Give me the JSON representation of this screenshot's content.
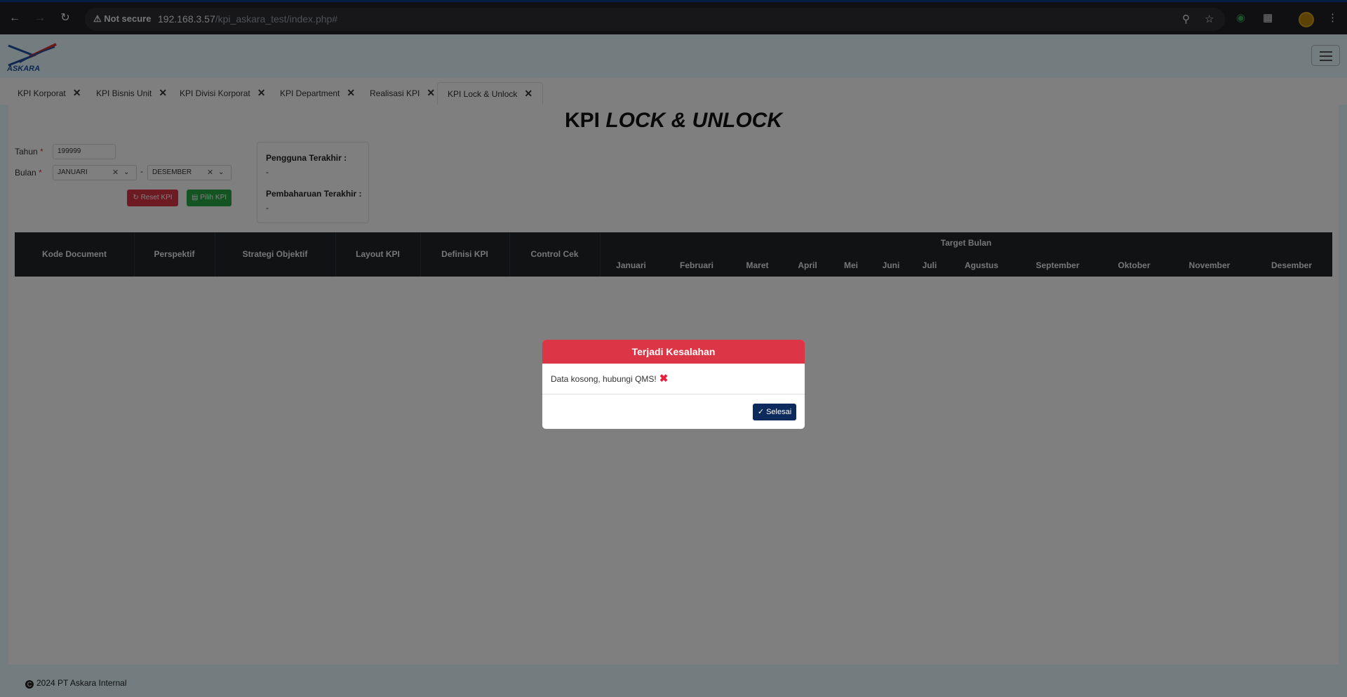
{
  "browser": {
    "security": "Not secure",
    "url_host": "192.168.3.57",
    "url_path": "/kpi_askara_test/index.php#"
  },
  "app": {
    "logo_text": "ASKARA"
  },
  "tabs": [
    {
      "label": "KPI Korporat"
    },
    {
      "label": "KPI Bisnis Unit"
    },
    {
      "label": "KPI Divisi Korporat"
    },
    {
      "label": "KPI Department"
    },
    {
      "label": "Realisasi KPI"
    },
    {
      "label": "KPI Lock & Unlock",
      "active": true
    }
  ],
  "page": {
    "title_prefix": "KPI",
    "title_italic": "LOCK & UNLOCK"
  },
  "form": {
    "tahun_label": "Tahun",
    "tahun_value": "199999",
    "bulan_label": "Bulan",
    "bulan_from": "JANUARI",
    "bulan_to": "DESEMBER",
    "separator": "-",
    "required_mark": "*",
    "reset_label": "Reset KPI",
    "pilih_label": "Pilih KPI"
  },
  "info": {
    "pengguna_label": "Pengguna Terakhir :",
    "pengguna_value": "-",
    "pembaharuan_label": "Pembaharuan Terakhir :",
    "pembaharuan_value": "-"
  },
  "table": {
    "headers": [
      "Kode Document",
      "Perspektif",
      "Strategi Objektif",
      "Layout KPI",
      "Definisi KPI",
      "Control Cek"
    ],
    "group_header": "Target Bulan",
    "months": [
      "Januari",
      "Februari",
      "Maret",
      "April",
      "Mei",
      "Juni",
      "Juli",
      "Agustus",
      "September",
      "Oktober",
      "November",
      "Desember"
    ]
  },
  "modal": {
    "title": "Terjadi Kesalahan",
    "message": "Data kosong, hubungi QMS!",
    "button": "Selesai"
  },
  "footer": {
    "text": "2024 PT Askara Internal"
  },
  "colors": {
    "danger": "#dc3545",
    "success": "#28a745",
    "navy": "#0d2a5c",
    "table_dark": "#212529"
  }
}
